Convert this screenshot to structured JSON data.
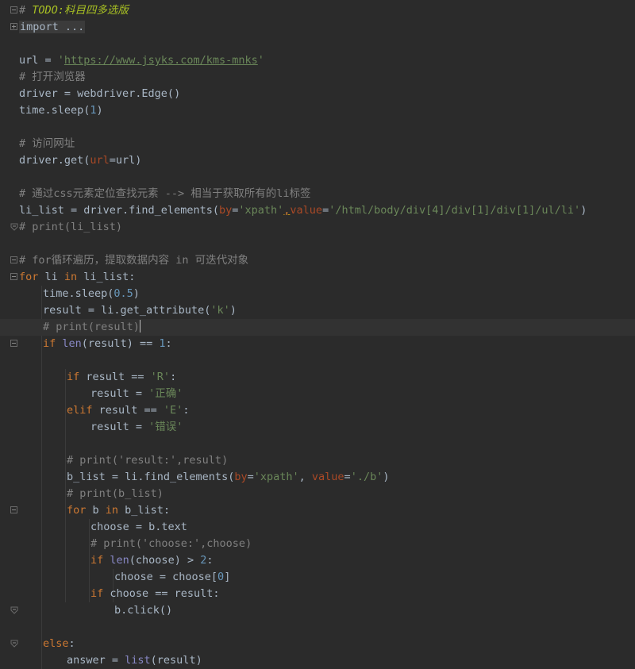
{
  "editor": {
    "lines": [
      {
        "fold": "minus",
        "indent": 0,
        "tokens": [
          {
            "c": "cmt",
            "v": "# "
          },
          {
            "c": "todo",
            "v": "TODO:科目四多选版"
          }
        ]
      },
      {
        "fold": "plus",
        "indent": 0,
        "tokens": [
          {
            "c": "fold",
            "v": "import ..."
          }
        ]
      },
      {
        "fold": "",
        "indent": 0,
        "tokens": []
      },
      {
        "fold": "",
        "indent": 0,
        "tokens": [
          {
            "c": "plain",
            "v": "url = "
          },
          {
            "c": "str",
            "v": "'"
          },
          {
            "c": "link",
            "v": "https://www.jsyks.com/kms-mnks"
          },
          {
            "c": "str",
            "v": "'"
          }
        ]
      },
      {
        "fold": "",
        "indent": 0,
        "tokens": [
          {
            "c": "cmt",
            "v": "# 打开浏览器"
          }
        ]
      },
      {
        "fold": "",
        "indent": 0,
        "tokens": [
          {
            "c": "plain",
            "v": "driver = webdriver.Edge()"
          }
        ]
      },
      {
        "fold": "",
        "indent": 0,
        "tokens": [
          {
            "c": "plain",
            "v": "time.sleep("
          },
          {
            "c": "num",
            "v": "1"
          },
          {
            "c": "plain",
            "v": ")"
          }
        ]
      },
      {
        "fold": "",
        "indent": 0,
        "tokens": []
      },
      {
        "fold": "",
        "indent": 0,
        "tokens": [
          {
            "c": "cmt",
            "v": "# 访问网址"
          }
        ]
      },
      {
        "fold": "",
        "indent": 0,
        "tokens": [
          {
            "c": "plain",
            "v": "driver.get("
          },
          {
            "c": "param",
            "v": "url"
          },
          {
            "c": "plain",
            "v": "=url)"
          }
        ]
      },
      {
        "fold": "",
        "indent": 0,
        "tokens": []
      },
      {
        "fold": "",
        "indent": 0,
        "tokens": [
          {
            "c": "cmt",
            "v": "# 通过css元素定位查找元素 --> 相当于获取所有的li标签"
          }
        ]
      },
      {
        "fold": "",
        "indent": 0,
        "tokens": [
          {
            "c": "plain",
            "v": "li_list = driver.find_elements("
          },
          {
            "c": "param",
            "v": "by"
          },
          {
            "c": "plain",
            "v": "="
          },
          {
            "c": "str",
            "v": "'xpath'"
          },
          {
            "c": "warn",
            "v": ","
          },
          {
            "c": "param",
            "v": "value"
          },
          {
            "c": "plain",
            "v": "="
          },
          {
            "c": "str",
            "v": "'/html/body/div[4]/div[1]/div[1]/ul/li'"
          },
          {
            "c": "plain",
            "v": ")"
          }
        ]
      },
      {
        "fold": "end",
        "indent": 0,
        "tokens": [
          {
            "c": "cmt",
            "v": "# print(li_list)"
          }
        ]
      },
      {
        "fold": "",
        "indent": 0,
        "tokens": []
      },
      {
        "fold": "minus",
        "indent": 0,
        "tokens": [
          {
            "c": "cmt",
            "v": "# for循环遍历，提取数据内容 in 可迭代对象"
          }
        ]
      },
      {
        "fold": "minus",
        "indent": 0,
        "tokens": [
          {
            "c": "kw",
            "v": "for"
          },
          {
            "c": "plain",
            "v": " li "
          },
          {
            "c": "kw",
            "v": "in"
          },
          {
            "c": "plain",
            "v": " li_list:"
          }
        ]
      },
      {
        "fold": "",
        "indent": 1,
        "tokens": [
          {
            "c": "plain",
            "v": "time.sleep("
          },
          {
            "c": "num",
            "v": "0.5"
          },
          {
            "c": "plain",
            "v": ")"
          }
        ]
      },
      {
        "fold": "",
        "indent": 1,
        "tokens": [
          {
            "c": "plain",
            "v": "result = li.get_attribute("
          },
          {
            "c": "str",
            "v": "'k'"
          },
          {
            "c": "plain",
            "v": ")"
          }
        ]
      },
      {
        "fold": "",
        "indent": 1,
        "current": true,
        "caret": true,
        "tokens": [
          {
            "c": "cmt",
            "v": "# print(result)"
          }
        ]
      },
      {
        "fold": "minus",
        "indent": 1,
        "tokens": [
          {
            "c": "kw",
            "v": "if"
          },
          {
            "c": "plain",
            "v": " "
          },
          {
            "c": "builtin",
            "v": "len"
          },
          {
            "c": "plain",
            "v": "(result) == "
          },
          {
            "c": "num",
            "v": "1"
          },
          {
            "c": "plain",
            "v": ":"
          }
        ]
      },
      {
        "fold": "",
        "indent": 0,
        "tokens": []
      },
      {
        "fold": "",
        "indent": 2,
        "tokens": [
          {
            "c": "kw",
            "v": "if"
          },
          {
            "c": "plain",
            "v": " result == "
          },
          {
            "c": "str",
            "v": "'R'"
          },
          {
            "c": "plain",
            "v": ":"
          }
        ]
      },
      {
        "fold": "",
        "indent": 3,
        "tokens": [
          {
            "c": "plain",
            "v": "result = "
          },
          {
            "c": "str",
            "v": "'正确'"
          }
        ]
      },
      {
        "fold": "",
        "indent": 2,
        "tokens": [
          {
            "c": "kw",
            "v": "elif"
          },
          {
            "c": "plain",
            "v": " result == "
          },
          {
            "c": "str",
            "v": "'E'"
          },
          {
            "c": "plain",
            "v": ":"
          }
        ]
      },
      {
        "fold": "",
        "indent": 3,
        "tokens": [
          {
            "c": "plain",
            "v": "result = "
          },
          {
            "c": "str",
            "v": "'错误'"
          }
        ]
      },
      {
        "fold": "",
        "indent": 0,
        "tokens": []
      },
      {
        "fold": "",
        "indent": 2,
        "tokens": [
          {
            "c": "cmt",
            "v": "# print('result:',result)"
          }
        ]
      },
      {
        "fold": "",
        "indent": 2,
        "tokens": [
          {
            "c": "plain",
            "v": "b_list = li.find_elements("
          },
          {
            "c": "param",
            "v": "by"
          },
          {
            "c": "plain",
            "v": "="
          },
          {
            "c": "str",
            "v": "'xpath'"
          },
          {
            "c": "plain",
            "v": ", "
          },
          {
            "c": "param",
            "v": "value"
          },
          {
            "c": "plain",
            "v": "="
          },
          {
            "c": "str",
            "v": "'./b'"
          },
          {
            "c": "plain",
            "v": ")"
          }
        ]
      },
      {
        "fold": "",
        "indent": 2,
        "tokens": [
          {
            "c": "cmt",
            "v": "# print(b_list)"
          }
        ]
      },
      {
        "fold": "minus",
        "indent": 2,
        "tokens": [
          {
            "c": "kw",
            "v": "for"
          },
          {
            "c": "plain",
            "v": " b "
          },
          {
            "c": "kw",
            "v": "in"
          },
          {
            "c": "plain",
            "v": " b_list:"
          }
        ]
      },
      {
        "fold": "",
        "indent": 3,
        "tokens": [
          {
            "c": "plain",
            "v": "choose = b.text"
          }
        ]
      },
      {
        "fold": "",
        "indent": 3,
        "tokens": [
          {
            "c": "cmt",
            "v": "# print('choose:',choose)"
          }
        ]
      },
      {
        "fold": "",
        "indent": 3,
        "tokens": [
          {
            "c": "kw",
            "v": "if"
          },
          {
            "c": "plain",
            "v": " "
          },
          {
            "c": "builtin",
            "v": "len"
          },
          {
            "c": "plain",
            "v": "(choose) > "
          },
          {
            "c": "num",
            "v": "2"
          },
          {
            "c": "plain",
            "v": ":"
          }
        ]
      },
      {
        "fold": "",
        "indent": 4,
        "tokens": [
          {
            "c": "plain",
            "v": "choose = choose["
          },
          {
            "c": "num",
            "v": "0"
          },
          {
            "c": "plain",
            "v": "]"
          }
        ]
      },
      {
        "fold": "",
        "indent": 3,
        "tokens": [
          {
            "c": "kw",
            "v": "if"
          },
          {
            "c": "plain",
            "v": " choose == result:"
          }
        ]
      },
      {
        "fold": "end",
        "indent": 4,
        "tokens": [
          {
            "c": "plain",
            "v": "b.click()"
          }
        ]
      },
      {
        "fold": "",
        "indent": 0,
        "tokens": []
      },
      {
        "fold": "end",
        "indent": 1,
        "tokens": [
          {
            "c": "kw",
            "v": "else"
          },
          {
            "c": "plain",
            "v": ":"
          }
        ]
      },
      {
        "fold": "",
        "indent": 2,
        "tokens": [
          {
            "c": "plain",
            "v": "answer = "
          },
          {
            "c": "builtin",
            "v": "list"
          },
          {
            "c": "plain",
            "v": "(result)"
          }
        ]
      }
    ]
  }
}
